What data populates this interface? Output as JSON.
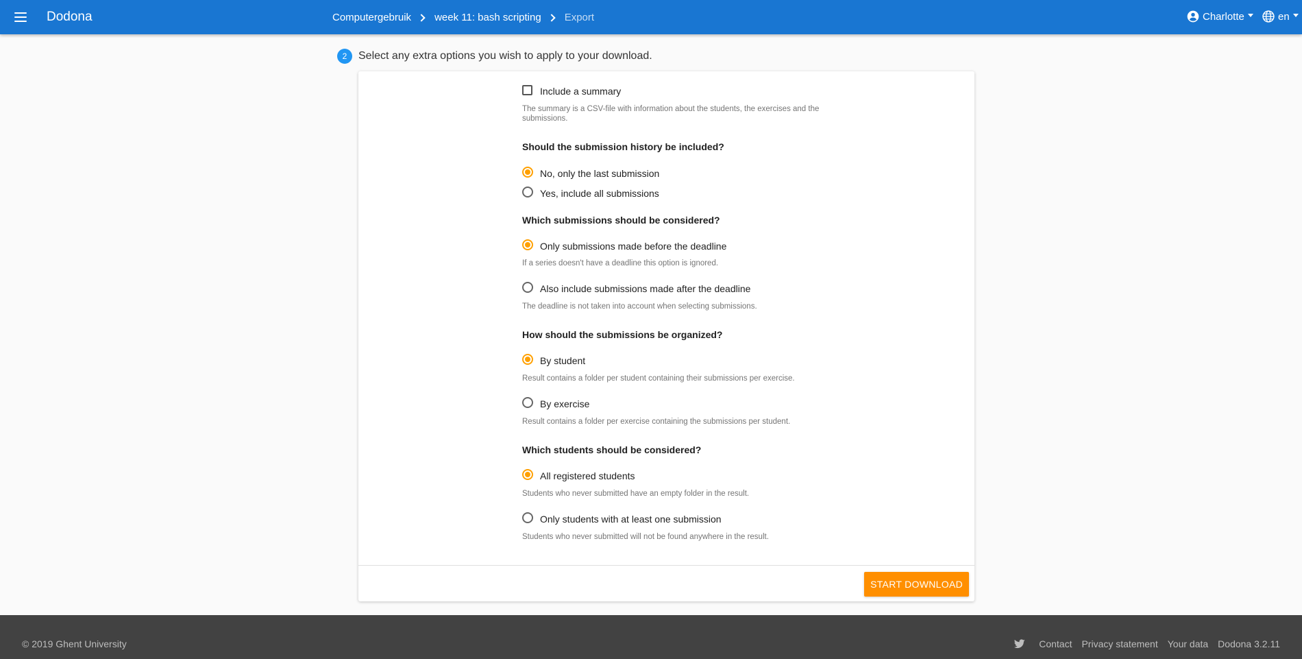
{
  "header": {
    "brand": "Dodona",
    "menu_icon": "hamburger-menu-icon",
    "breadcrumbs": [
      "Computergebruik",
      "week 11: bash scripting",
      "Export"
    ],
    "user": "Charlotte",
    "user_icon": "account-circle-icon",
    "language": "en",
    "language_icon": "globe-icon",
    "bar_color": "#1976d2"
  },
  "step": {
    "number": "2",
    "text": "Select any extra options you wish to apply to your download."
  },
  "options": {
    "summary": {
      "label": "Include a summary",
      "checked": false,
      "help": "The summary is a CSV-file with information about the students, the exercises and the submissions."
    },
    "history": {
      "question": "Should the submission history be included?",
      "choices": [
        {
          "label": "No, only the last submission",
          "checked": true
        },
        {
          "label": "Yes, include all submissions",
          "checked": false
        }
      ]
    },
    "deadline": {
      "question": "Which submissions should be considered?",
      "choices": [
        {
          "label": "Only submissions made before the deadline",
          "checked": true,
          "help": "If a series doesn't have a deadline this option is ignored."
        },
        {
          "label": "Also include submissions made after the deadline",
          "checked": false,
          "help": "The deadline is not taken into account when selecting submissions."
        }
      ]
    },
    "organize": {
      "question": "How should the submissions be organized?",
      "choices": [
        {
          "label": "By student",
          "checked": true,
          "help": "Result contains a folder per student containing their submissions per exercise."
        },
        {
          "label": "By exercise",
          "checked": false,
          "help": "Result contains a folder per exercise containing the submissions per student."
        }
      ]
    },
    "students": {
      "question": "Which students should be considered?",
      "choices": [
        {
          "label": "All registered students",
          "checked": true,
          "help": "Students who never submitted have an empty folder in the result."
        },
        {
          "label": "Only students with at least one submission",
          "checked": false,
          "help": "Students who never submitted will not be found anywhere in the result."
        }
      ]
    }
  },
  "actions": {
    "start_download": "START DOWNLOAD",
    "button_color": "#ff8f00"
  },
  "footer": {
    "copyright": "© 2019 Ghent University",
    "twitter_icon": "twitter-icon",
    "links": [
      "Contact",
      "Privacy statement",
      "Your data",
      "Dodona 3.2.11"
    ]
  }
}
